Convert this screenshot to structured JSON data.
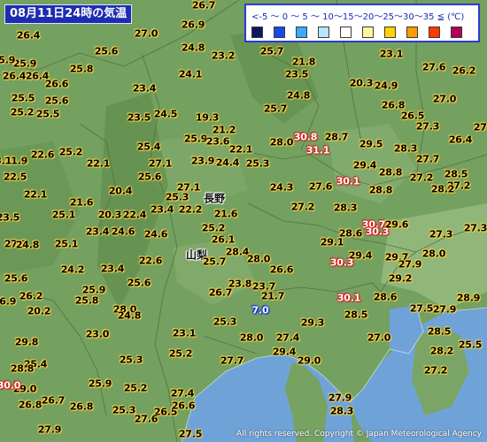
{
  "title": "08月11日24時の気温",
  "legend": {
    "scale_text": "<-5 〜 0 〜 5 〜 10〜15〜20〜25〜30〜35 ≦ (℃)",
    "swatch_colors": [
      "#0a1a5c",
      "#1b4ae6",
      "#3aa8ff",
      "#b9e4ff",
      "#ffffff",
      "#fff7a0",
      "#ffd200",
      "#ff9a00",
      "#ff3a00",
      "#b4005a"
    ]
  },
  "places": [
    {
      "name": "長野"
    },
    {
      "name": "山梨"
    }
  ],
  "copyright": "All rights reserved. Copyright © Japan Meteorological Agency",
  "observations": [
    {
      "v": "26.7",
      "t": "A"
    },
    {
      "v": "26.4",
      "t": "A"
    },
    {
      "v": "27.0",
      "t": "A"
    },
    {
      "v": "26.9",
      "t": "A"
    },
    {
      "v": "26.4",
      "t": "A"
    },
    {
      "v": "25.9",
      "t": "A"
    },
    {
      "v": "25.6",
      "t": "A"
    },
    {
      "v": "24.8",
      "t": "A"
    },
    {
      "v": "23.2",
      "t": "A"
    },
    {
      "v": "25.7",
      "t": "A"
    },
    {
      "v": "23.1",
      "t": "A"
    },
    {
      "v": "25.9",
      "t": "A"
    },
    {
      "v": "26.4",
      "t": "A"
    },
    {
      "v": "25.8",
      "t": "A"
    },
    {
      "v": "21.8",
      "t": "A"
    },
    {
      "v": "27.6",
      "t": "A"
    },
    {
      "v": "26.6",
      "t": "A"
    },
    {
      "v": "24.1",
      "t": "A"
    },
    {
      "v": "23.5",
      "t": "A"
    },
    {
      "v": "26.2",
      "t": "A"
    },
    {
      "v": "25.6",
      "t": "A"
    },
    {
      "v": "24.9",
      "t": "A"
    },
    {
      "v": "20.3",
      "t": "A"
    },
    {
      "v": "23.4",
      "t": "A"
    },
    {
      "v": "25.5",
      "t": "A"
    },
    {
      "v": "24.8",
      "t": "A"
    },
    {
      "v": "27.0",
      "t": "A"
    },
    {
      "v": "25.5",
      "t": "A"
    },
    {
      "v": "25.2",
      "t": "A"
    },
    {
      "v": "26.8",
      "t": "A"
    },
    {
      "v": "25.7",
      "t": "A"
    },
    {
      "v": "23.5",
      "t": "A"
    },
    {
      "v": "24.5",
      "t": "A"
    },
    {
      "v": "19.3",
      "t": "A"
    },
    {
      "v": "26.5",
      "t": "A"
    },
    {
      "v": "27.3",
      "t": "A"
    },
    {
      "v": "21.2",
      "t": "A"
    },
    {
      "v": "25.9",
      "t": "A"
    },
    {
      "v": "23.6",
      "t": "A"
    },
    {
      "v": "28.0",
      "t": "A"
    },
    {
      "v": "30.8",
      "t": "C"
    },
    {
      "v": "28.7",
      "t": "A"
    },
    {
      "v": "29.5",
      "t": "A"
    },
    {
      "v": "26.4",
      "t": "A"
    },
    {
      "v": "27.6",
      "t": "A"
    },
    {
      "v": "25.4",
      "t": "A"
    },
    {
      "v": "22.1",
      "t": "A"
    },
    {
      "v": "31.1",
      "t": "C"
    },
    {
      "v": "28.3",
      "t": "A"
    },
    {
      "v": "21.9",
      "t": "A"
    },
    {
      "v": "22.6",
      "t": "A"
    },
    {
      "v": "25.2",
      "t": "A"
    },
    {
      "v": "22.1",
      "t": "A"
    },
    {
      "v": "27.1",
      "t": "A"
    },
    {
      "v": "23.9",
      "t": "A"
    },
    {
      "v": "24.4",
      "t": "A"
    },
    {
      "v": "25.3",
      "t": "A"
    },
    {
      "v": "29.4",
      "t": "A"
    },
    {
      "v": "27.7",
      "t": "A"
    },
    {
      "v": "23.1",
      "t": "A"
    },
    {
      "v": "25.6",
      "t": "A"
    },
    {
      "v": "28.8",
      "t": "A"
    },
    {
      "v": "28.5",
      "t": "A"
    },
    {
      "v": "22.5",
      "t": "A"
    },
    {
      "v": "30.1",
      "t": "C"
    },
    {
      "v": "27.2",
      "t": "A"
    },
    {
      "v": "27.2",
      "t": "A"
    },
    {
      "v": "24.3",
      "t": "A"
    },
    {
      "v": "27.6",
      "t": "A"
    },
    {
      "v": "28.2",
      "t": "A"
    },
    {
      "v": "20.4",
      "t": "A"
    },
    {
      "v": "28.8",
      "t": "A"
    },
    {
      "v": "27.1",
      "t": "A"
    },
    {
      "v": "22.1",
      "t": "A"
    },
    {
      "v": "21.6",
      "t": "A"
    },
    {
      "v": "25.3",
      "t": "A"
    },
    {
      "v": "27.2",
      "t": "A"
    },
    {
      "v": "28.3",
      "t": "A"
    },
    {
      "v": "23.4",
      "t": "A"
    },
    {
      "v": "22.2",
      "t": "A"
    },
    {
      "v": "21.6",
      "t": "A"
    },
    {
      "v": "20.3",
      "t": "A"
    },
    {
      "v": "22.4",
      "t": "A"
    },
    {
      "v": "30.7",
      "t": "C"
    },
    {
      "v": "29.6",
      "t": "A"
    },
    {
      "v": "27.3",
      "t": "A"
    },
    {
      "v": "23.5",
      "t": "A"
    },
    {
      "v": "25.1",
      "t": "A"
    },
    {
      "v": "28.6",
      "t": "A"
    },
    {
      "v": "24.6",
      "t": "A"
    },
    {
      "v": "27.3",
      "t": "A"
    },
    {
      "v": "23.4",
      "t": "A"
    },
    {
      "v": "24.6",
      "t": "A"
    },
    {
      "v": "26.1",
      "t": "A"
    },
    {
      "v": "29.1",
      "t": "A"
    },
    {
      "v": "30.3",
      "t": "C"
    },
    {
      "v": "28.0",
      "t": "A"
    },
    {
      "v": "25.1",
      "t": "A"
    },
    {
      "v": "25.2",
      "t": "A"
    },
    {
      "v": "28.4",
      "t": "A"
    },
    {
      "v": "29.4",
      "t": "A"
    },
    {
      "v": "29.7",
      "t": "A"
    },
    {
      "v": "27.1",
      "t": "A"
    },
    {
      "v": "24.8",
      "t": "A"
    },
    {
      "v": "24.2",
      "t": "A"
    },
    {
      "v": "23.4",
      "t": "A"
    },
    {
      "v": "22.6",
      "t": "A"
    },
    {
      "v": "25.7",
      "t": "A"
    },
    {
      "v": "28.0",
      "t": "A"
    },
    {
      "v": "26.6",
      "t": "A"
    },
    {
      "v": "27.9",
      "t": "A"
    },
    {
      "v": "29.2",
      "t": "A"
    },
    {
      "v": "30.3",
      "t": "C"
    },
    {
      "v": "25.6",
      "t": "A"
    },
    {
      "v": "25.9",
      "t": "A"
    },
    {
      "v": "25.6",
      "t": "A"
    },
    {
      "v": "23.8",
      "t": "A"
    },
    {
      "v": "23.7",
      "t": "A"
    },
    {
      "v": "26.2",
      "t": "A"
    },
    {
      "v": "25.8",
      "t": "A"
    },
    {
      "v": "26.7",
      "t": "A"
    },
    {
      "v": "21.7",
      "t": "A"
    },
    {
      "v": "30.1",
      "t": "C"
    },
    {
      "v": "28.6",
      "t": "A"
    },
    {
      "v": "28.9",
      "t": "A"
    },
    {
      "v": "26.9",
      "t": "A"
    },
    {
      "v": "20.2",
      "t": "A"
    },
    {
      "v": "7.0",
      "t": "E"
    },
    {
      "v": "27.5",
      "t": "A"
    },
    {
      "v": "28.0",
      "t": "A"
    },
    {
      "v": "24.8",
      "t": "A"
    },
    {
      "v": "27.9",
      "t": "A"
    },
    {
      "v": "29.3",
      "t": "A"
    },
    {
      "v": "28.5",
      "t": "A"
    },
    {
      "v": "25.3",
      "t": "A"
    },
    {
      "v": "23.0",
      "t": "A"
    },
    {
      "v": "23.1",
      "t": "A"
    },
    {
      "v": "28.0",
      "t": "A"
    },
    {
      "v": "27.0",
      "t": "A"
    },
    {
      "v": "28.5",
      "t": "A"
    },
    {
      "v": "29.8",
      "t": "A"
    },
    {
      "v": "27.4",
      "t": "A"
    },
    {
      "v": "25.3",
      "t": "A"
    },
    {
      "v": "25.2",
      "t": "A"
    },
    {
      "v": "29.4",
      "t": "A"
    },
    {
      "v": "28.2",
      "t": "A"
    },
    {
      "v": "25.5",
      "t": "A"
    },
    {
      "v": "25.4",
      "t": "A"
    },
    {
      "v": "27.7",
      "t": "A"
    },
    {
      "v": "29.0",
      "t": "A"
    },
    {
      "v": "28.8",
      "t": "A"
    },
    {
      "v": "29.0",
      "t": "A"
    },
    {
      "v": "27.2",
      "t": "A"
    },
    {
      "v": "30.0",
      "t": "C"
    },
    {
      "v": "26.8",
      "t": "A"
    },
    {
      "v": "25.9",
      "t": "A"
    },
    {
      "v": "25.2",
      "t": "A"
    },
    {
      "v": "26.7",
      "t": "A"
    },
    {
      "v": "27.4",
      "t": "A"
    },
    {
      "v": "27.9",
      "t": "A"
    },
    {
      "v": "26.5",
      "t": "A"
    },
    {
      "v": "26.6",
      "t": "A"
    },
    {
      "v": "26.8",
      "t": "A"
    },
    {
      "v": "25.3",
      "t": "A"
    },
    {
      "v": "28.3",
      "t": "A"
    },
    {
      "v": "27.9",
      "t": "A"
    },
    {
      "v": "27.6",
      "t": "A"
    },
    {
      "v": "27.5",
      "t": "A"
    }
  ]
}
